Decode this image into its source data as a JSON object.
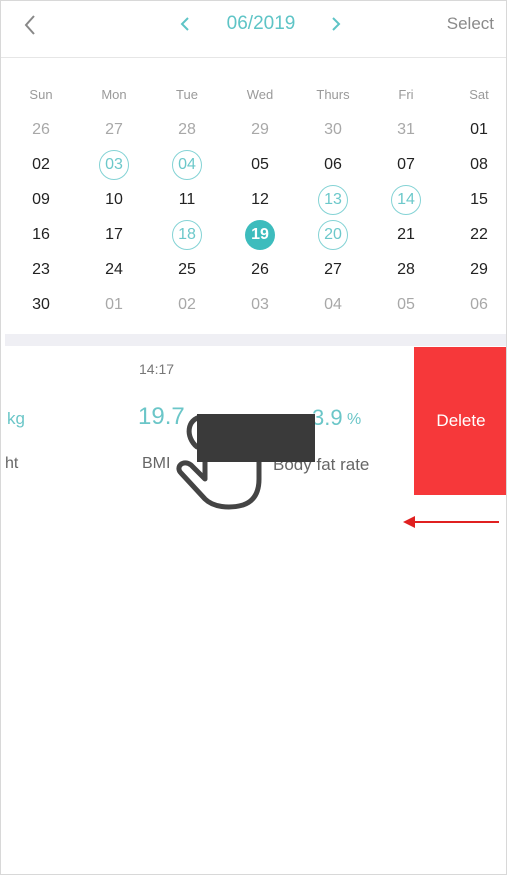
{
  "header": {
    "month": "06/2019",
    "select_label": "Select",
    "back_icon": "chevron-left-icon",
    "prev_icon": "chevron-left-icon",
    "next_icon": "chevron-right-icon"
  },
  "calendar": {
    "weekdays": [
      "Sun",
      "Mon",
      "Tue",
      "Wed",
      "Thurs",
      "Fri",
      "Sat"
    ],
    "weeks": [
      [
        "26",
        "27",
        "28",
        "29",
        "30",
        "31",
        "01"
      ],
      [
        "02",
        "03",
        "04",
        "05",
        "06",
        "07",
        "08"
      ],
      [
        "09",
        "10",
        "11",
        "12",
        "13",
        "14",
        "15"
      ],
      [
        "16",
        "17",
        "18",
        "19",
        "20",
        "21",
        "22"
      ],
      [
        "23",
        "24",
        "25",
        "26",
        "27",
        "28",
        "29"
      ],
      [
        "30",
        "01",
        "02",
        "03",
        "04",
        "05",
        "06"
      ]
    ],
    "selected_day": "19",
    "ringed_days": [
      "03",
      "04",
      "13",
      "14",
      "18",
      "20"
    ],
    "accent_color": "#3dbcbd"
  },
  "record": {
    "time": "14:17",
    "weight_unit_fragment": "kg",
    "weight_label_fragment": "ht",
    "bmi_value": "19.7",
    "bmi_label": "BMI",
    "body_fat_fragment": "3.9",
    "body_fat_unit": "%",
    "body_fat_label": "Body fat rate"
  },
  "delete_label": "Delete",
  "delete_color": "#f6383a",
  "overlays": {
    "hand_icon": "swipe-hand-icon",
    "arrow_icon": "arrow-left-icon",
    "arrow_color": "#e02020"
  }
}
